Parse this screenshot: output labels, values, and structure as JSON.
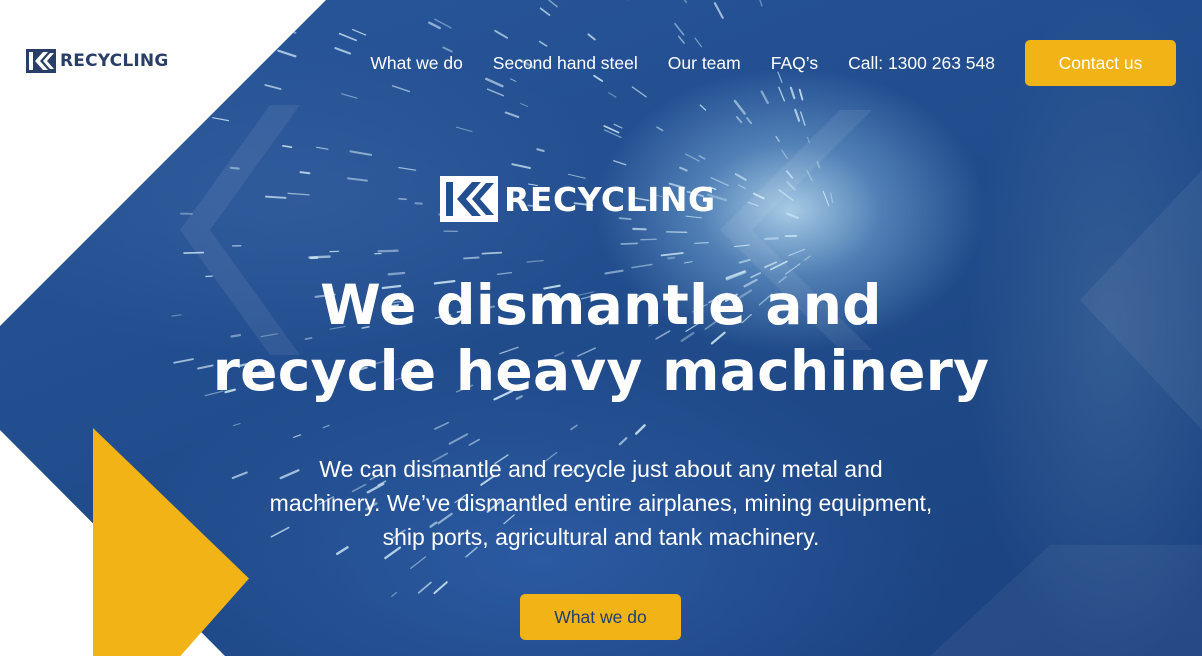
{
  "brand": {
    "name": "RECYCLING"
  },
  "nav": {
    "items": [
      "What we do",
      "Second hand steel",
      "Our team",
      "FAQ’s"
    ],
    "call": "Call: 1300 263 548",
    "contact_label": "Contact us"
  },
  "hero": {
    "title_line1": "We dismantle and",
    "title_line2": "recycle heavy machinery",
    "text_line1": "We can dismantle and recycle just about any metal and",
    "text_line2": "machinery. We’ve dismantled entire airplanes, mining equipment,",
    "text_line3": "ship ports, agricultural and tank machinery.",
    "cta_label": "What we do"
  },
  "colors": {
    "brand_navy": "#2a3f68",
    "hero_blue": "#234f91",
    "accent_yellow": "#f2b316"
  },
  "icons": {
    "logo_mark": "k-arrow-logo-icon"
  }
}
